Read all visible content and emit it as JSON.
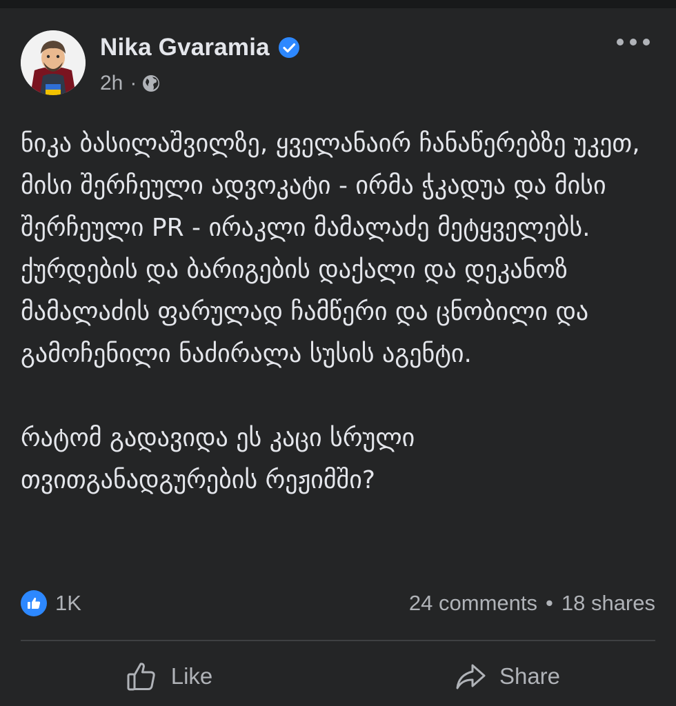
{
  "post": {
    "author": "Nika Gvaramia",
    "verified": true,
    "time": "2h",
    "meta_separator": "·",
    "audience_icon": "globe-icon",
    "more_icon": "more-horizontal-icon",
    "paragraphs": [
      "ნიკა ბასილაშვილზე, ყველანაირ ჩანაწერებზე უკეთ, მისი შერჩეული ადვოკატი - ირმა ჭკადუა და მისი შერჩეული PR - ირაკლი მამალაძე მეტყველებს. ქურდების და ბარიგების დაქალი და დეკანოზ მამალაძის ფარულად ჩამწერი და ცნობილი და გამოჩენილი ნაძირალა სუსის აგენტი.",
      "რატომ გადავიდა ეს კაცი სრული თვითგანადგურების რეჟიმში?"
    ]
  },
  "stats": {
    "reaction_icon": "like-reaction-icon",
    "likes": "1K",
    "comments": "24 comments",
    "separator": "•",
    "shares": "18 shares"
  },
  "actions": {
    "like_label": "Like",
    "share_label": "Share"
  },
  "colors": {
    "background": "#242526",
    "text_primary": "#e4e6eb",
    "text_secondary": "#b0b3b8",
    "accent": "#2d88ff",
    "divider": "#3e4042"
  }
}
